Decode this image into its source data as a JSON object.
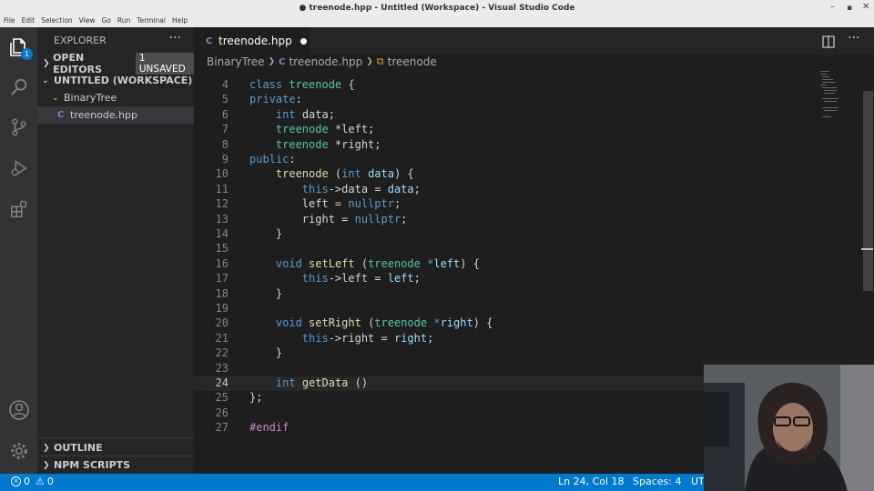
{
  "window": {
    "title": "● treenode.hpp - Untitled (Workspace) - Visual Studio Code"
  },
  "menu": [
    "File",
    "Edit",
    "Selection",
    "View",
    "Go",
    "Run",
    "Terminal",
    "Help"
  ],
  "activity_bar": {
    "explorer_badge": "1"
  },
  "sidebar": {
    "title": "EXPLORER",
    "open_editors": {
      "label": "OPEN EDITORS",
      "badge": "1 UNSAVED"
    },
    "workspace": {
      "label": "UNTITLED (WORKSPACE)"
    },
    "folder": "BinaryTree",
    "file": "treenode.hpp",
    "outline": "OUTLINE",
    "npm": "NPM SCRIPTS"
  },
  "editor": {
    "tab": {
      "label": "treenode.hpp"
    },
    "breadcrumb": {
      "folder": "BinaryTree",
      "file": "treenode.hpp",
      "symbol": "treenode"
    },
    "lines": [
      {
        "n": "4",
        "t": [
          [
            "kw",
            "class "
          ],
          [
            "ty",
            "treenode"
          ],
          [
            "pu",
            " {"
          ]
        ]
      },
      {
        "n": "5",
        "t": [
          [
            "kw",
            "private"
          ],
          [
            "pu",
            ":"
          ]
        ]
      },
      {
        "n": "6",
        "t": [
          [
            "pu",
            "    "
          ],
          [
            "kw",
            "int"
          ],
          [
            "pu",
            " data;"
          ]
        ]
      },
      {
        "n": "7",
        "t": [
          [
            "pu",
            "    "
          ],
          [
            "ty",
            "treenode"
          ],
          [
            "pu",
            " *left;"
          ]
        ]
      },
      {
        "n": "8",
        "t": [
          [
            "pu",
            "    "
          ],
          [
            "ty",
            "treenode"
          ],
          [
            "pu",
            " *right;"
          ]
        ]
      },
      {
        "n": "9",
        "t": [
          [
            "kw",
            "public"
          ],
          [
            "pu",
            ":"
          ]
        ]
      },
      {
        "n": "10",
        "t": [
          [
            "pu",
            "    "
          ],
          [
            "fn",
            "treenode"
          ],
          [
            "pu",
            " ("
          ],
          [
            "kw",
            "int"
          ],
          [
            "pu",
            " "
          ],
          [
            "vr",
            "data"
          ],
          [
            "pu",
            ") {"
          ]
        ]
      },
      {
        "n": "11",
        "t": [
          [
            "pu",
            "        "
          ],
          [
            "kw",
            "this"
          ],
          [
            "pu",
            "->data = "
          ],
          [
            "vr",
            "data"
          ],
          [
            "pu",
            ";"
          ]
        ]
      },
      {
        "n": "12",
        "t": [
          [
            "pu",
            "        left = "
          ],
          [
            "kw",
            "nullptr"
          ],
          [
            "pu",
            ";"
          ]
        ]
      },
      {
        "n": "13",
        "t": [
          [
            "pu",
            "        right = "
          ],
          [
            "kw",
            "nullptr"
          ],
          [
            "pu",
            ";"
          ]
        ]
      },
      {
        "n": "14",
        "t": [
          [
            "pu",
            "    }"
          ]
        ]
      },
      {
        "n": "15",
        "t": []
      },
      {
        "n": "16",
        "t": [
          [
            "pu",
            "    "
          ],
          [
            "kw",
            "void"
          ],
          [
            "pu",
            " "
          ],
          [
            "fn",
            "setLeft"
          ],
          [
            "pu",
            " ("
          ],
          [
            "ty",
            "treenode"
          ],
          [
            "pu",
            " "
          ],
          [
            "kw",
            "*"
          ],
          [
            "vr",
            "left"
          ],
          [
            "pu",
            ") {"
          ]
        ]
      },
      {
        "n": "17",
        "t": [
          [
            "pu",
            "        "
          ],
          [
            "kw",
            "this"
          ],
          [
            "pu",
            "->left = "
          ],
          [
            "vr",
            "left"
          ],
          [
            "pu",
            ";"
          ]
        ]
      },
      {
        "n": "18",
        "t": [
          [
            "pu",
            "    }"
          ]
        ]
      },
      {
        "n": "19",
        "t": []
      },
      {
        "n": "20",
        "t": [
          [
            "pu",
            "    "
          ],
          [
            "kw",
            "void"
          ],
          [
            "pu",
            " "
          ],
          [
            "fn",
            "setRight"
          ],
          [
            "pu",
            " ("
          ],
          [
            "ty",
            "treenode"
          ],
          [
            "pu",
            " "
          ],
          [
            "kw",
            "*"
          ],
          [
            "vr",
            "right"
          ],
          [
            "pu",
            ") {"
          ]
        ]
      },
      {
        "n": "21",
        "t": [
          [
            "pu",
            "        "
          ],
          [
            "kw",
            "this"
          ],
          [
            "pu",
            "->right = "
          ],
          [
            "vr",
            "right"
          ],
          [
            "pu",
            ";"
          ]
        ]
      },
      {
        "n": "22",
        "t": [
          [
            "pu",
            "    }"
          ]
        ]
      },
      {
        "n": "23",
        "t": []
      },
      {
        "n": "24",
        "t": [
          [
            "pu",
            "    "
          ],
          [
            "kw",
            "int"
          ],
          [
            "pu",
            " "
          ],
          [
            "fn",
            "getData"
          ],
          [
            "pu",
            " ()"
          ]
        ]
      },
      {
        "n": "25",
        "t": [
          [
            "pu",
            "};"
          ]
        ]
      },
      {
        "n": "26",
        "t": []
      },
      {
        "n": "27",
        "t": [
          [
            "pp",
            "#endif"
          ]
        ]
      }
    ]
  },
  "status": {
    "errors": "0",
    "warnings": "0",
    "position": "Ln 24, Col 18",
    "spaces": "Spaces: 4",
    "encoding": "UT"
  }
}
